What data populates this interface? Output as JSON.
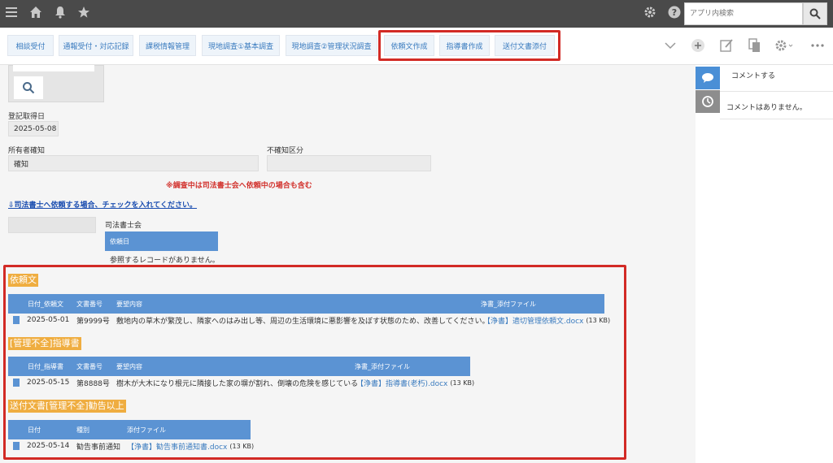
{
  "header": {
    "search_placeholder": "アプリ内検索",
    "icons": [
      "menu-icon",
      "home-icon",
      "bell-icon",
      "star-icon",
      "gear-icon",
      "help-icon",
      "search-icon"
    ]
  },
  "toolbar": {
    "buttons": [
      "相談受付",
      "通報受付・対応記録",
      "課税情報管理",
      "現地調査①基本調査",
      "現地調査②管理状況調査",
      "依頼文作成",
      "指導書作成",
      "送付文書添付"
    ]
  },
  "form": {
    "registration_date_label": "登記取得日",
    "registration_date_value": "2025-05-08",
    "owner_confirm_label": "所有者確知",
    "owner_confirm_value": "確知",
    "unknown_category_label": "不確知区分",
    "unknown_category_value": "",
    "note_red": "※調査中は司法書士会へ依頼中の場合も含む",
    "note_link": "⇩司法書士へ依頼する場合、チェックを入れてください。",
    "scriveners_label": "司法書士会",
    "request_date_header": "依頼日",
    "no_records": "参照するレコードがありません。"
  },
  "sections": [
    {
      "title": "依頼文",
      "headers": [
        "日付_依頼文",
        "文書番号",
        "要望内容",
        "浄書_添付ファイル"
      ],
      "rows": [
        {
          "date": "2025-05-01",
          "number": "第9999号",
          "content": "敷地内の草木が繁茂し、隣家へのはみ出し等、周辺の生活環境に悪影響を及ぼす状態のため、改善してください。",
          "file": "【浄書】適切管理依頼文.docx",
          "size": "(13 KB)"
        }
      ]
    },
    {
      "title": "[管理不全]指導書",
      "headers": [
        "日付_指導書",
        "文書番号",
        "要望内容",
        "浄書_添付ファイル"
      ],
      "rows": [
        {
          "date": "2025-05-15",
          "number": "第8888号",
          "content": "樹木が大木になり根元に隣接した家の塀が割れ、倒壊の危険を感じている",
          "file": "【浄書】指導書(老朽).docx",
          "size": "(13 KB)"
        }
      ]
    },
    {
      "title": "送付文書[管理不全]勧告以上",
      "headers": [
        "日付",
        "種別",
        "添付ファイル"
      ],
      "rows": [
        {
          "date": "2025-05-14",
          "kind": "勧告事前通知",
          "file": "【浄書】勧告事前通知書.docx",
          "size": "(13 KB)"
        }
      ]
    }
  ],
  "comments": {
    "comment_label": "コメントする",
    "no_comments": "コメントはありません。"
  },
  "colors": {
    "accent_blue": "#5b93d3",
    "highlight_red": "#d22a25",
    "section_orange": "#efad40",
    "topbar": "#4a4a4a"
  }
}
